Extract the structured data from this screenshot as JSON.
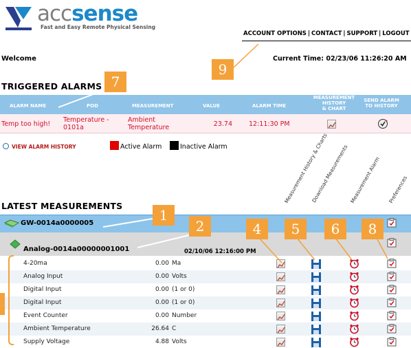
{
  "logo": {
    "brand_a": "acc",
    "brand_b": "sense",
    "tagline": "Fast and Easy Remote Physical Sensing"
  },
  "topnav": {
    "items": [
      "ACCOUNT OPTIONS",
      "CONTACT",
      "SUPPORT",
      "LOGOUT"
    ]
  },
  "welcome": "Welcome",
  "current_time": "Current Time: 02/23/06 11:26:20 AM",
  "triggered_alarms": {
    "title": "TRIGGERED ALARMS",
    "headers": {
      "alarm_name": "ALARM NAME",
      "pod": "POD",
      "measurement": "MEASUREMENT",
      "value": "VALUE",
      "alarm_time": "ALARM TIME",
      "history_chart_1": "MEASUREMENT",
      "history_chart_2": "HISTORY",
      "history_chart_3": "& CHART",
      "send_alarm_1": "SEND ALARM",
      "send_alarm_2": "TO HISTORY"
    },
    "row": {
      "alarm_name": "Temp too high!",
      "pod_1": "Temperature -",
      "pod_2": "0101a",
      "measurement_1": "Ambient",
      "measurement_2": "Temperature",
      "value": "23.74",
      "alarm_time": "12:11:30 PM"
    },
    "view_history": "VIEW ALARM HISTORY",
    "legend": {
      "active": "Active Alarm",
      "inactive": "Inactive Alarm"
    }
  },
  "latest": {
    "title": "LATEST MEASUREMENTS",
    "column_headers": {
      "history": "Measurement History & Charts",
      "download": "Download Measurements",
      "alarm": "Measurement Alarm",
      "preferences": "Preferences"
    },
    "gateway": "GW-0014a0000005",
    "pod": "Analog-0014a00000001001",
    "pod_time": "02/10/06 12:16:00 PM",
    "measurements": [
      {
        "name": "4-20ma",
        "value": "0.00",
        "unit": "Ma"
      },
      {
        "name": "Analog Input",
        "value": "0.00",
        "unit": "Volts"
      },
      {
        "name": "Digital Input",
        "value": "0.00",
        "unit": "(1 or 0)"
      },
      {
        "name": "Digital Input",
        "value": "0.00",
        "unit": "(1 or 0)"
      },
      {
        "name": "Event Counter",
        "value": "0.00",
        "unit": "Number"
      },
      {
        "name": "Ambient Temperature",
        "value": "26.64",
        "unit": "C"
      },
      {
        "name": "Supply Voltage",
        "value": "4.88",
        "unit": "Volts"
      }
    ]
  },
  "callouts": [
    "1",
    "2",
    "4",
    "5",
    "6",
    "7",
    "8",
    "9"
  ],
  "colors": {
    "brand_blue": "#1c88c9",
    "header_blue": "#8fc3e8",
    "alarm_red": "#d0102a",
    "callout_orange": "#f4a13a"
  }
}
